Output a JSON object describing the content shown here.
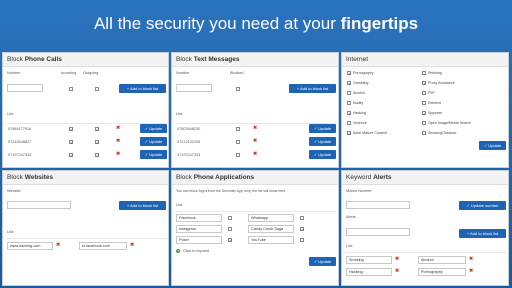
{
  "headline": {
    "prefix": "All the security you need at your ",
    "bold": "fingertips"
  },
  "calls": {
    "title_prefix": "Block ",
    "title_bold": "Phone Calls",
    "col_number": "Number",
    "col_incoming": "Incoming",
    "col_outgoing": "Outgoing",
    "add_label": "+ Add to block list",
    "list_label": "List:",
    "rows": [
      {
        "number": "07984177916",
        "incoming": true,
        "outgoing": true
      },
      {
        "number": "07410648827",
        "incoming": true,
        "outgoing": true
      },
      {
        "number": "07197247333",
        "incoming": true,
        "outgoing": true
      }
    ],
    "update_label": "✓ Update"
  },
  "texts": {
    "title_prefix": "Block ",
    "title_bold": "Text Messages",
    "col_number": "Number",
    "col_blocked": "Blocked",
    "add_label": "+ Add to block list",
    "list_label": "List:",
    "rows": [
      {
        "number": "07807648230",
        "blocked": false
      },
      {
        "number": "07212122205",
        "blocked": false
      },
      {
        "number": "07197247333",
        "blocked": false
      }
    ],
    "update_label": "✓ Update"
  },
  "internet": {
    "title": "Internet",
    "left": [
      {
        "label": "Pornography",
        "on": true
      },
      {
        "label": "Gambling",
        "on": true
      },
      {
        "label": "Alcohol",
        "on": false
      },
      {
        "label": "Nudity",
        "on": false
      },
      {
        "label": "Hacking",
        "on": true
      },
      {
        "label": "Violence",
        "on": false
      },
      {
        "label": "Adult Mature Content",
        "on": true
      }
    ],
    "right": [
      {
        "label": "Phishing",
        "on": false
      },
      {
        "label": "Proxy Avoidance",
        "on": true
      },
      {
        "label": "P2P",
        "on": false
      },
      {
        "label": "Extreme",
        "on": false
      },
      {
        "label": "Spyware",
        "on": true
      },
      {
        "label": "Open Image/Media Search",
        "on": false
      },
      {
        "label": "Smoking/Tobacco",
        "on": false
      }
    ],
    "update_label": "✓ Update"
  },
  "websites": {
    "title_prefix": "Block ",
    "title_bold": "Websites",
    "col_website": "Website",
    "add_label": "+ Add to block list",
    "list_label": "List:",
    "items": [
      "www.hacking.com",
      "m.facebook.com"
    ]
  },
  "apps": {
    "title_prefix": "Block ",
    "title_bold": "Phone Applications",
    "note": "You can block App's from the Securikin App only, the list will show here",
    "list_label": "List:",
    "left": [
      {
        "name": "Facebook",
        "on": false
      },
      {
        "name": "Instagram",
        "on": false
      },
      {
        "name": "Poker",
        "on": true
      }
    ],
    "right": [
      {
        "name": "Whatsapp",
        "on": false
      },
      {
        "name": "Candy Crush Saga",
        "on": true
      },
      {
        "name": "YouTube",
        "on": false
      }
    ],
    "expand_label": "Click to expand",
    "update_label": "✓ Update"
  },
  "keywords": {
    "title_prefix": "Keyword ",
    "title_bold": "Alerts",
    "col_mobile": "Mobile Number",
    "update_number_label": "✓ Update number",
    "col_alerts": "Alerts",
    "add_label": "+ Add to block list",
    "list_label": "List:",
    "items": [
      "Smoking",
      "Alcohol",
      "Hacking",
      "Pornography"
    ]
  }
}
